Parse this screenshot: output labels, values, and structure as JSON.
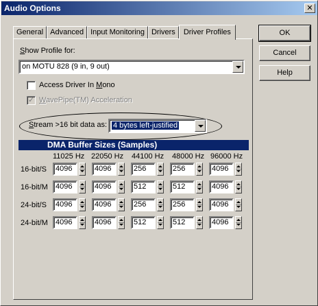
{
  "window": {
    "title": "Audio Options",
    "close_glyph": "✕"
  },
  "tabs": [
    "General",
    "Advanced",
    "Input Monitoring",
    "Drivers",
    "Driver Profiles"
  ],
  "buttons": {
    "ok": "OK",
    "cancel": "Cancel",
    "help": "Help"
  },
  "profile": {
    "label_prefix": "S",
    "label_rest": "how Profile for:",
    "selected": "on MOTU 828 (9 in, 9 out)"
  },
  "options": {
    "mono_label_a": "Access Driver In ",
    "mono_label_u": "M",
    "mono_label_b": "ono",
    "mono_checked": false,
    "wavepipe_label_u": "W",
    "wavepipe_label_rest": "avePipe(TM) Acceleration",
    "wavepipe_checked": true
  },
  "stream": {
    "label_u": "S",
    "label_rest": "tream >16 bit data as:",
    "selected": "4 bytes left-justified"
  },
  "dma": {
    "header": "DMA Buffer Sizes (Samples)",
    "columns": [
      "11025 Hz",
      "22050 Hz",
      "44100 Hz",
      "48000 Hz",
      "96000 Hz"
    ],
    "rows": [
      {
        "label": "16-bit/S",
        "values": [
          "4096",
          "4096",
          "256",
          "256",
          "4096"
        ]
      },
      {
        "label": "16-bit/M",
        "values": [
          "4096",
          "4096",
          "512",
          "512",
          "4096"
        ]
      },
      {
        "label": "24-bit/S",
        "values": [
          "4096",
          "4096",
          "256",
          "256",
          "4096"
        ]
      },
      {
        "label": "24-bit/M",
        "values": [
          "4096",
          "4096",
          "512",
          "512",
          "4096"
        ]
      }
    ]
  },
  "colors": {
    "title_bar": "#0a246a",
    "face": "#d4d0c8",
    "selection": "#0a246a"
  }
}
